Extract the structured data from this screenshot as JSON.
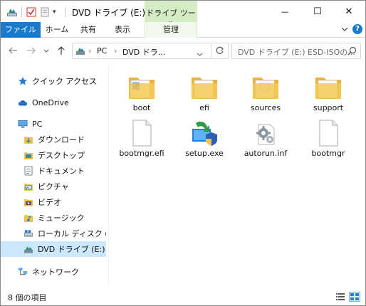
{
  "titlebar": {
    "title": "DVD ドライブ (E:) ESD...",
    "context_tab_title": "ドライブ ツール",
    "qa_dropdown": "▾",
    "minimize": "—",
    "maximize": "☐",
    "close": "✕"
  },
  "ribbon": {
    "tabs": [
      {
        "label": "ファイル"
      },
      {
        "label": "ホーム"
      },
      {
        "label": "共有"
      },
      {
        "label": "表示"
      },
      {
        "label": "管理"
      }
    ],
    "help": "?"
  },
  "address": {
    "crumbs": [
      "PC",
      "DVD ドラ..."
    ],
    "separator": "›",
    "search_placeholder": "DVD ドライブ (E:) ESD-ISOの..."
  },
  "sidebar": {
    "items": [
      {
        "label": "クイック アクセス",
        "icon": "star-icon"
      },
      {
        "label": "OneDrive",
        "icon": "cloud-icon"
      },
      {
        "label": "PC",
        "icon": "computer-icon"
      },
      {
        "label": "ダウンロード",
        "icon": "download-folder-icon"
      },
      {
        "label": "デスクトップ",
        "icon": "desktop-folder-icon"
      },
      {
        "label": "ドキュメント",
        "icon": "documents-folder-icon"
      },
      {
        "label": "ピクチャ",
        "icon": "pictures-folder-icon"
      },
      {
        "label": "ビデオ",
        "icon": "videos-folder-icon"
      },
      {
        "label": "ミュージック",
        "icon": "music-folder-icon"
      },
      {
        "label": "ローカル ディスク (C:)",
        "icon": "local-disk-icon"
      },
      {
        "label": "DVD ドライブ (E:) ESD",
        "icon": "dvd-drive-icon"
      },
      {
        "label": "ネットワーク",
        "icon": "network-icon"
      }
    ]
  },
  "files": [
    {
      "name": "boot",
      "type": "folder"
    },
    {
      "name": "efi",
      "type": "folder"
    },
    {
      "name": "sources",
      "type": "folder"
    },
    {
      "name": "support",
      "type": "folder"
    },
    {
      "name": "bootmgr.efi",
      "type": "file"
    },
    {
      "name": "setup.exe",
      "type": "setup"
    },
    {
      "name": "autorun.inf",
      "type": "settings"
    },
    {
      "name": "bootmgr",
      "type": "file"
    }
  ],
  "status": {
    "item_count": "8 個の項目"
  },
  "colors": {
    "accent": "#1979ca",
    "context_tab": "#d6ecc4",
    "selection": "#cce8ff",
    "folder": "#f5c957"
  }
}
